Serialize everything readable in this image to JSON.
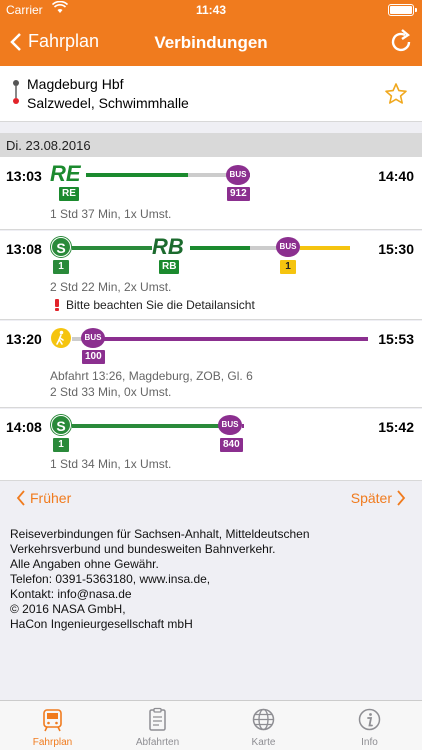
{
  "status": {
    "carrier": "Carrier",
    "time": "11:43"
  },
  "nav": {
    "back_label": "Fahrplan",
    "title": "Verbindungen"
  },
  "route": {
    "from": "Magdeburg Hbf",
    "to": "Salzwedel, Schwimmhalle"
  },
  "date_header": "Di. 23.08.2016",
  "connections": [
    {
      "dep": "13:03",
      "arr": "14:40",
      "logo": "RE",
      "badges": [
        "RE",
        "912"
      ],
      "bus_label": "BUS",
      "duration": "1 Std 37 Min, 1x Umst."
    },
    {
      "dep": "13:08",
      "arr": "15:30",
      "s_label": "S",
      "logo": "RB",
      "badges": [
        "1",
        "RB",
        "1"
      ],
      "bus_label": "BUS",
      "duration": "2 Std 22 Min, 2x Umst.",
      "note": "Bitte beachten Sie die Detailansicht"
    },
    {
      "dep": "13:20",
      "arr": "15:53",
      "bus_label": "BUS",
      "badges": [
        "100"
      ],
      "departure_info": "Abfahrt 13:26, Magdeburg, ZOB, Gl. 6",
      "duration": "2 Std 33 Min, 0x Umst."
    },
    {
      "dep": "14:08",
      "arr": "15:42",
      "s_label": "S",
      "badges": [
        "1",
        "840"
      ],
      "bus_label": "BUS",
      "duration": "1 Std 34 Min, 1x Umst."
    }
  ],
  "pager": {
    "earlier": "Früher",
    "later": "Später"
  },
  "info_lines": [
    "Reiseverbindungen für Sachsen-Anhalt, Mitteldeutschen",
    "Verkehrsverbund und bundesweiten Bahnverkehr.",
    "Alle Angaben ohne Gewähr.",
    "Telefon: 0391-5363180, www.insa.de,",
    "Kontakt: info@nasa.de",
    "© 2016 NASA GmbH,",
    "HaCon Ingenieurgesellschaft mbH"
  ],
  "tabs": [
    {
      "label": "Fahrplan",
      "icon": "train-icon"
    },
    {
      "label": "Abfahrten",
      "icon": "clipboard-icon"
    },
    {
      "label": "Karte",
      "icon": "globe-icon"
    },
    {
      "label": "Info",
      "icon": "info-icon"
    }
  ],
  "colors": {
    "accent": "#f07b1e",
    "regional_green": "#1b8a2e",
    "bus_purple": "#8b2f8f",
    "yellow": "#f5c40f",
    "walk_grey": "#cccccc"
  }
}
